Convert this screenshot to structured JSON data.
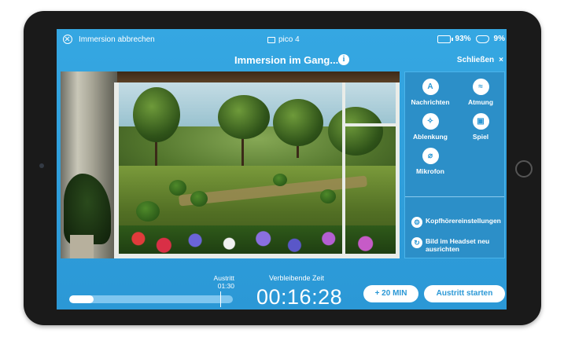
{
  "status": {
    "cancel_label": "Immersion abbrechen",
    "device_name": "pico 4",
    "tablet_battery": "93%",
    "headset_battery": "9%"
  },
  "header": {
    "title": "Immersion im Gang...",
    "close_label": "Schließen",
    "close_glyph": "×",
    "info_glyph": "i"
  },
  "tools": [
    {
      "label": "Nachrichten",
      "icon": "message-icon",
      "glyph": "A"
    },
    {
      "label": "Atmung",
      "icon": "breathing-icon",
      "glyph": "≈"
    },
    {
      "label": "Ablenkung",
      "icon": "distraction-icon",
      "glyph": "✧"
    },
    {
      "label": "Spiel",
      "icon": "game-icon",
      "glyph": "▣"
    },
    {
      "label": "Mikrofon",
      "icon": "microphone-muted-icon",
      "glyph": "⌀"
    }
  ],
  "settings": [
    {
      "label": "Kopfhörereinstellungen",
      "icon": "headphones-settings-icon",
      "glyph": "⚙"
    },
    {
      "label": "Bild im Headset neu ausrichten",
      "icon": "recenter-icon",
      "glyph": "↻"
    }
  ],
  "footer": {
    "exit_label": "Austritt",
    "exit_time": "01:30",
    "remaining_label": "Verbleibende Zeit",
    "remaining_time": "00:16:28",
    "progress_fraction": 0.15,
    "add_time_button": "+ 20 MIN",
    "start_exit_button": "Austritt starten"
  },
  "colors": {
    "accent": "#2b98d6",
    "panel": "#2c8fc8"
  }
}
